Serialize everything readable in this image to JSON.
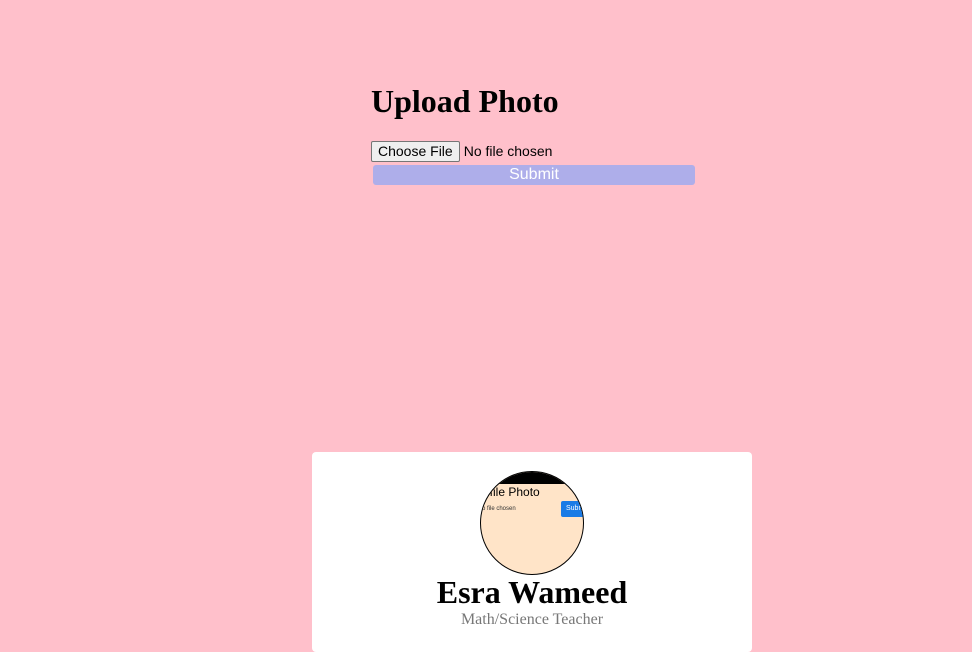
{
  "upload": {
    "title": "Upload Photo",
    "choose_file_label": "Choose File",
    "file_status": "No file chosen",
    "submit_label": "Submit"
  },
  "profile": {
    "avatar_preview": {
      "heading": "ofile Photo",
      "file_text": "o file chosen",
      "submit_label": "Subm"
    },
    "name": "Esra Wameed",
    "role": "Math/Science Teacher"
  },
  "colors": {
    "page_background": "#ffc0cb",
    "submit_button": "#aeaeea",
    "card_background": "#ffffff",
    "role_text": "#777777",
    "avatar_submit": "#1a7be6"
  }
}
